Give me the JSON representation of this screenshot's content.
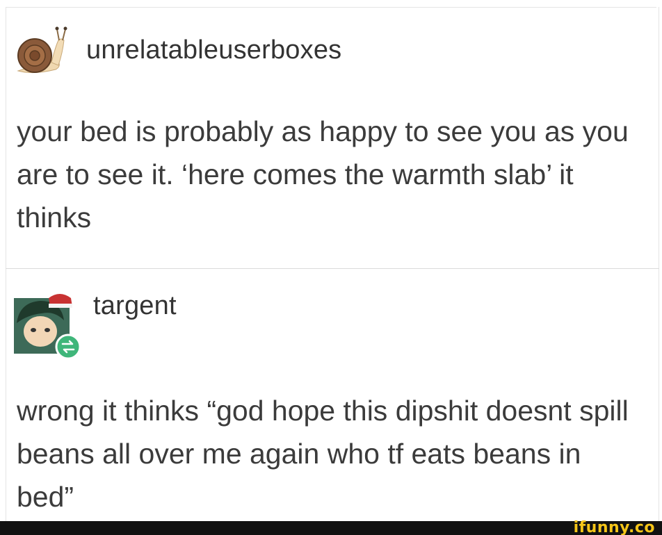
{
  "posts": [
    {
      "username": "unrelatableuserboxes",
      "avatar_icon": "snail-icon",
      "text": "your bed is probably as happy to see you as you are to see it. ‘here comes the warmth slab’ it thinks"
    },
    {
      "username": "targent",
      "avatar_icon": "cartoon-avatar-icon",
      "reblog_icon": "reblog-icon",
      "text": "wrong it thinks “god hope this dipshit doesnt spill beans all over me again who tf eats beans in bed”"
    }
  ],
  "watermark": {
    "text": "ifunny.co"
  },
  "colors": {
    "text": "#3b3b3b",
    "reblog_badge": "#3fb67a",
    "watermark": "#f5c518",
    "footer": "#111111"
  }
}
